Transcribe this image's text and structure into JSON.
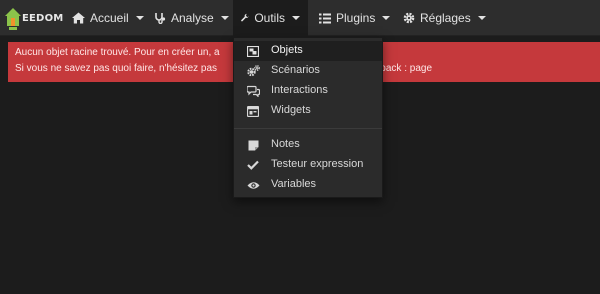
{
  "brand": {
    "logo_text": "EEDOM"
  },
  "nav": {
    "items": [
      {
        "label": "Accueil",
        "icon": "home-icon"
      },
      {
        "label": "Analyse",
        "icon": "stethoscope-icon"
      },
      {
        "label": "Outils",
        "icon": "wrench-icon"
      },
      {
        "label": "Plugins",
        "icon": "tasks-icon"
      },
      {
        "label": "Réglages",
        "icon": "cogs-icon"
      }
    ]
  },
  "alert": {
    "line1": "Aucun objet racine trouvé. Pour en créer un, a",
    "line2_start": "Si vous ne savez pas quoi faire, n'hésitez pas",
    "line2_end": "là si vous avez un pack : ",
    "link": "page"
  },
  "outils_menu": {
    "items": [
      {
        "label": "Objets",
        "icon": "object-group-icon"
      },
      {
        "label": "Scénarios",
        "icon": "cogs-icon"
      },
      {
        "label": "Interactions",
        "icon": "comments-icon"
      },
      {
        "label": "Widgets",
        "icon": "window-icon"
      },
      {
        "label": "Notes",
        "icon": "sticky-note-icon"
      },
      {
        "label": "Testeur expression",
        "icon": "check-icon"
      },
      {
        "label": "Variables",
        "icon": "eye-icon"
      }
    ]
  },
  "colors": {
    "navbar": "#2d2d2d",
    "background": "#1c1c1c",
    "alert": "#c5393c",
    "dropdown": "#2b2b2b",
    "logo_green": "#8bc34a",
    "logo_orange": "#f0932b"
  }
}
